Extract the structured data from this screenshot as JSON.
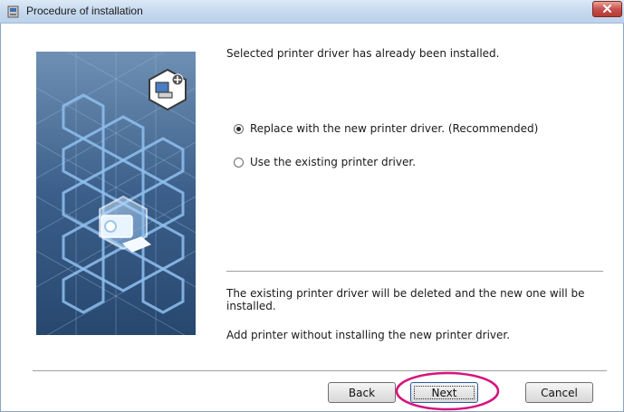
{
  "window": {
    "title": "Procedure of installation",
    "icons": {
      "app": "installer-icon",
      "close": "close-icon"
    }
  },
  "art": {
    "icons": {
      "badge": "add-printer-icon",
      "printer": "printer-icon"
    },
    "colors": {
      "background": "#2f4f7a",
      "hexagon": "#7fb2e6"
    }
  },
  "content": {
    "message": "Selected printer driver has already been installed.",
    "options": [
      {
        "label": "Replace with the new printer driver. (Recommended)",
        "selected": true
      },
      {
        "label": "Use the existing printer driver.",
        "selected": false
      }
    ],
    "description": [
      "The existing printer driver will be deleted and the new one will be installed.",
      "Add printer without installing the new printer driver."
    ]
  },
  "buttons": {
    "back": "Back",
    "next": "Next",
    "cancel": "Cancel"
  },
  "colors": {
    "highlight_ring": "#d4147c"
  }
}
